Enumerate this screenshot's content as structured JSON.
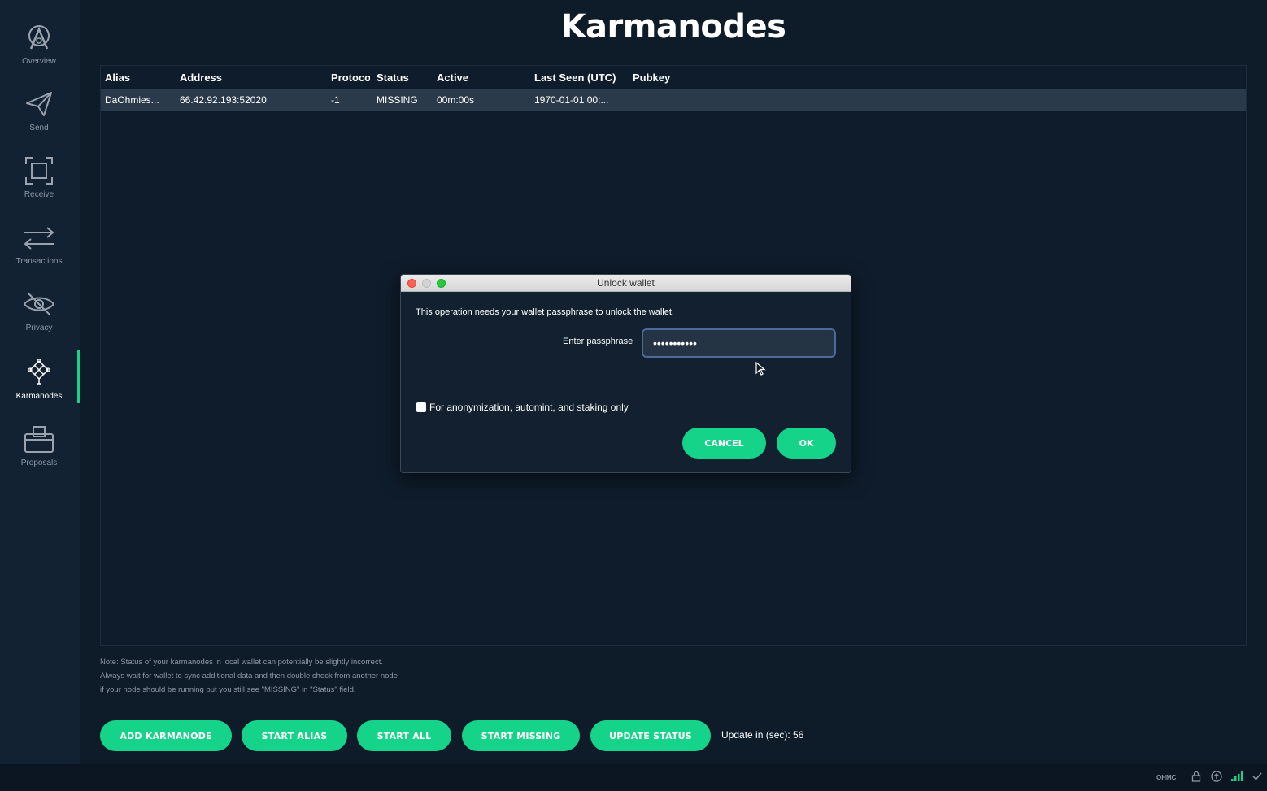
{
  "app": {
    "title": "Karmanodes",
    "accent": "#15d48a",
    "background": "#0e1b29"
  },
  "sidebar": {
    "items": [
      {
        "label": "Overview",
        "icon": "karma-logo-icon"
      },
      {
        "label": "Send",
        "icon": "paper-plane-icon"
      },
      {
        "label": "Receive",
        "icon": "receive-frame-icon"
      },
      {
        "label": "Transactions",
        "icon": "arrows-icon"
      },
      {
        "label": "Privacy",
        "icon": "eye-off-icon"
      },
      {
        "label": "Karmanodes",
        "icon": "karmanode-knot-icon",
        "active": true
      },
      {
        "label": "Proposals",
        "icon": "ballot-box-icon"
      }
    ]
  },
  "table": {
    "columns": [
      "Alias",
      "Address",
      "Protocol",
      "Status",
      "Active",
      "Last Seen (UTC)",
      "Pubkey"
    ],
    "rows": [
      {
        "alias": "DaOhmies...",
        "address": "66.42.92.193:52020",
        "protocol": "-1",
        "status": "MISSING",
        "active": "00m:00s",
        "last_seen": "1970-01-01 00:...",
        "pubkey": ""
      }
    ]
  },
  "note": {
    "line1": "Note: Status of your karmanodes in local wallet can potentially be slightly incorrect.",
    "line2": "Always wait for wallet to sync additional data and then double check from another node",
    "line3": "if your node should be running but you still see \"MISSING\" in \"Status\" field."
  },
  "actions": {
    "add": "ADD KARMANODE",
    "start_alias": "START ALIAS",
    "start_all": "START ALL",
    "start_missing": "START MISSING",
    "update_status": "UPDATE STATUS",
    "update_label": "Update in (sec):",
    "update_value": "56"
  },
  "statusbar": {
    "unit": "OHMC"
  },
  "dialog": {
    "title": "Unlock wallet",
    "message": "This operation needs your wallet passphrase to unlock the wallet.",
    "pass_label": "Enter passphrase",
    "pass_value": "•••••••••••",
    "checkbox_label": "For anonymization, automint, and staking only",
    "checkbox_checked": false,
    "cancel": "CANCEL",
    "ok": "OK"
  }
}
